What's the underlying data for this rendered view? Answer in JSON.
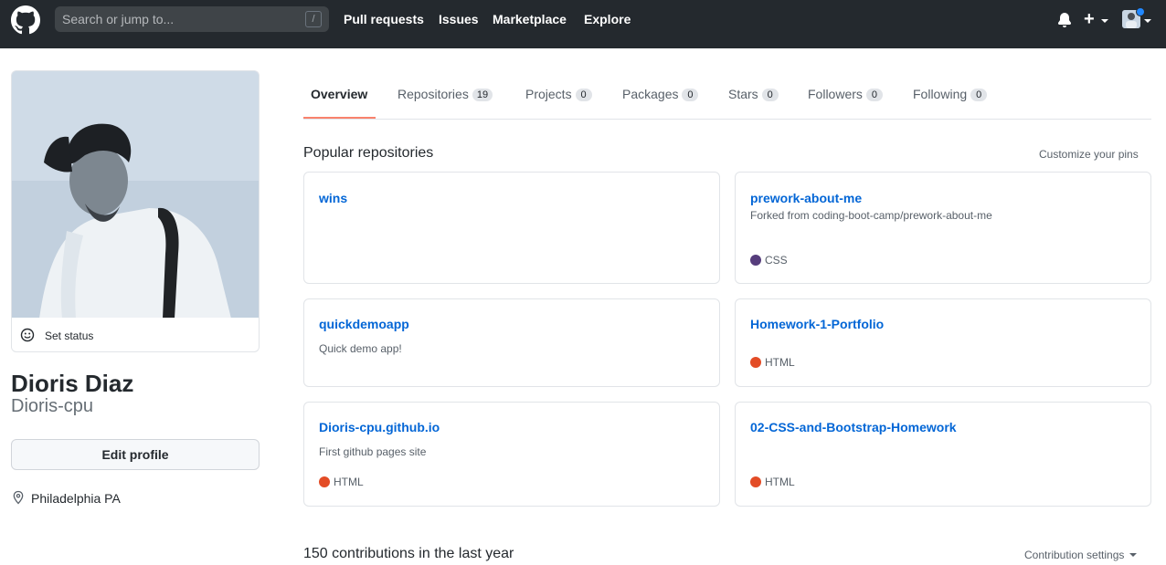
{
  "header": {
    "search_placeholder": "Search or jump to...",
    "search_shortcut": "/",
    "nav": [
      "Pull requests",
      "Issues",
      "Marketplace",
      "Explore"
    ],
    "plus": "+"
  },
  "profile": {
    "set_status": "Set status",
    "name": "Dioris Diaz",
    "login": "Dioris-cpu",
    "edit_profile": "Edit profile",
    "location": "Philadelphia PA"
  },
  "tabs": [
    {
      "label": "Overview",
      "count": null
    },
    {
      "label": "Repositories",
      "count": "19"
    },
    {
      "label": "Projects",
      "count": "0"
    },
    {
      "label": "Packages",
      "count": "0"
    },
    {
      "label": "Stars",
      "count": "0"
    },
    {
      "label": "Followers",
      "count": "0"
    },
    {
      "label": "Following",
      "count": "0"
    }
  ],
  "popular": {
    "title": "Popular repositories",
    "customize": "Customize your pins",
    "repos": [
      {
        "name": "wins",
        "description": "",
        "language": ""
      },
      {
        "name": "prework-about-me",
        "description": "Forked from coding-boot-camp/prework-about-me",
        "language": "CSS"
      },
      {
        "name": "quickdemoapp",
        "description": "Quick demo app!",
        "language": ""
      },
      {
        "name": "Homework-1-Portfolio",
        "description": "",
        "language": "HTML"
      },
      {
        "name": "Dioris-cpu.github.io",
        "description": "First github pages site",
        "language": "HTML"
      },
      {
        "name": "02-CSS-and-Bootstrap-Homework",
        "description": "",
        "language": "HTML"
      }
    ]
  },
  "contributions": {
    "summary": "150 contributions in the last year",
    "settings": "Contribution settings"
  },
  "colors": {
    "header_bg": "#24292e",
    "link": "#0366d6",
    "tab_underline": "#f9826c",
    "css_lang": "#563d7c",
    "html_lang": "#e34c26"
  }
}
